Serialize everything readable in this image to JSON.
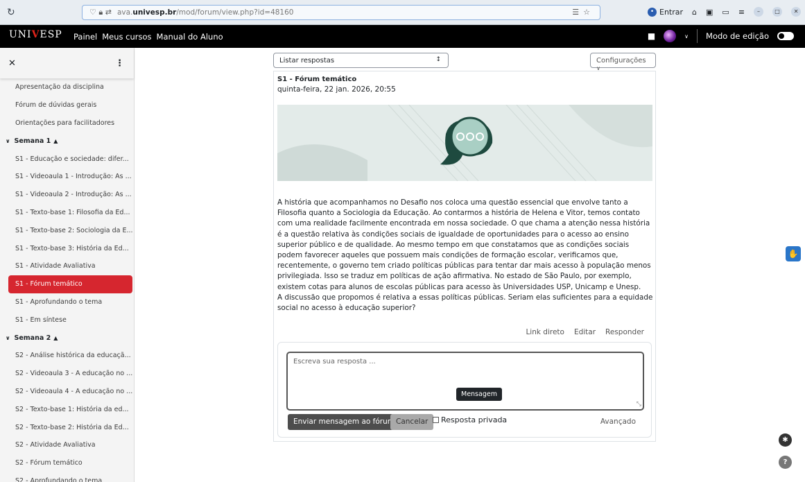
{
  "browser": {
    "url_prefix": "ava.",
    "url_host": "univesp.br",
    "url_path": "/mod/forum/view.php?id=48160",
    "signin_label": "Entrar"
  },
  "topnav": {
    "logo_left": "UNI",
    "logo_v": "V",
    "logo_right": "ESP",
    "links": [
      "Painel",
      "Meus cursos",
      "Manual do Aluno"
    ],
    "edit_mode_label": "Modo de edição"
  },
  "sidebar": {
    "items": [
      {
        "label": "Apresentação da disciplina",
        "type": "item"
      },
      {
        "label": "Fórum de dúvidas gerais",
        "type": "item"
      },
      {
        "label": "Orientações para facilitadores",
        "type": "item"
      },
      {
        "label": "Semana 1",
        "type": "section"
      },
      {
        "label": "S1 - Educação e sociedade: difer...",
        "type": "item"
      },
      {
        "label": "S1 - Videoaula 1 - Introdução: As ...",
        "type": "item"
      },
      {
        "label": "S1 - Videoaula 2 - Introdução: As ...",
        "type": "item"
      },
      {
        "label": "S1 - Texto-base 1: Filosofia da Ed...",
        "type": "item"
      },
      {
        "label": "S1 - Texto-base 2: Sociologia da E...",
        "type": "item"
      },
      {
        "label": "S1 - Texto-base 3: História da Ed...",
        "type": "item"
      },
      {
        "label": "S1 - Atividade Avaliativa",
        "type": "item"
      },
      {
        "label": "S1 - Fórum temático",
        "type": "active"
      },
      {
        "label": "S1 - Aprofundando o tema",
        "type": "item"
      },
      {
        "label": "S1 - Em síntese",
        "type": "item"
      },
      {
        "label": "Semana 2",
        "type": "section"
      },
      {
        "label": "S2 - Análise histórica da educaçã...",
        "type": "item"
      },
      {
        "label": "S2 - Videoaula 3 - A educação no ...",
        "type": "item"
      },
      {
        "label": "S2 - Videoaula 4 - A educação no ...",
        "type": "item"
      },
      {
        "label": "S2 - Texto-base 1: História da ed...",
        "type": "item"
      },
      {
        "label": "S2 - Texto-base 2: História da Ed...",
        "type": "item"
      },
      {
        "label": "S2 - Atividade Avaliativa",
        "type": "item"
      },
      {
        "label": "S2 - Fórum temático",
        "type": "item"
      },
      {
        "label": "S2 - Aprofundando o tema",
        "type": "item"
      }
    ]
  },
  "toolbar": {
    "select_value": "Listar respostas",
    "config_label": "Configurações"
  },
  "post": {
    "title": "S1 - Fórum temático",
    "date": "quinta-feira, 22 jan. 2026, 20:55",
    "body_p1": "A história que acompanhamos no Desafio nos coloca uma questão essencial que envolve tanto a Filosofia quanto a Sociologia da Educação. Ao contarmos a história de Helena e Vitor, temos contato com uma realidade facilmente encontrada em nossa sociedade. O que chama a atenção nessa história é a questão relativa às condições sociais de igualdade de oportunidades para o acesso ao ensino superior público e de qualidade. Ao mesmo tempo em que constatamos que as condições sociais podem favorecer aqueles que possuem mais condições de formação escolar, verificamos que, recentemente, o governo tem criado políticas públicas para tentar dar mais acesso à população menos privilegiada. Isso se traduz em políticas de ação afirmativa. No estado de São Paulo, por exemplo, existem cotas para alunos de escolas públicas para acesso às Universidades USP, Unicamp e Unesp.",
    "body_p2": "A discussão que propomos é relativa a essas políticas públicas. Seriam elas suficientes para a equidade social no acesso à educação superior?",
    "actions": [
      "Link direto",
      "Editar",
      "Responder"
    ]
  },
  "reply": {
    "placeholder": "Escreva sua resposta ...",
    "tooltip": "Mensagem",
    "send_label": "Enviar mensagem ao fórum",
    "cancel_label": "Cancelar",
    "private_label": "Resposta privada",
    "advanced_label": "Avançado"
  }
}
